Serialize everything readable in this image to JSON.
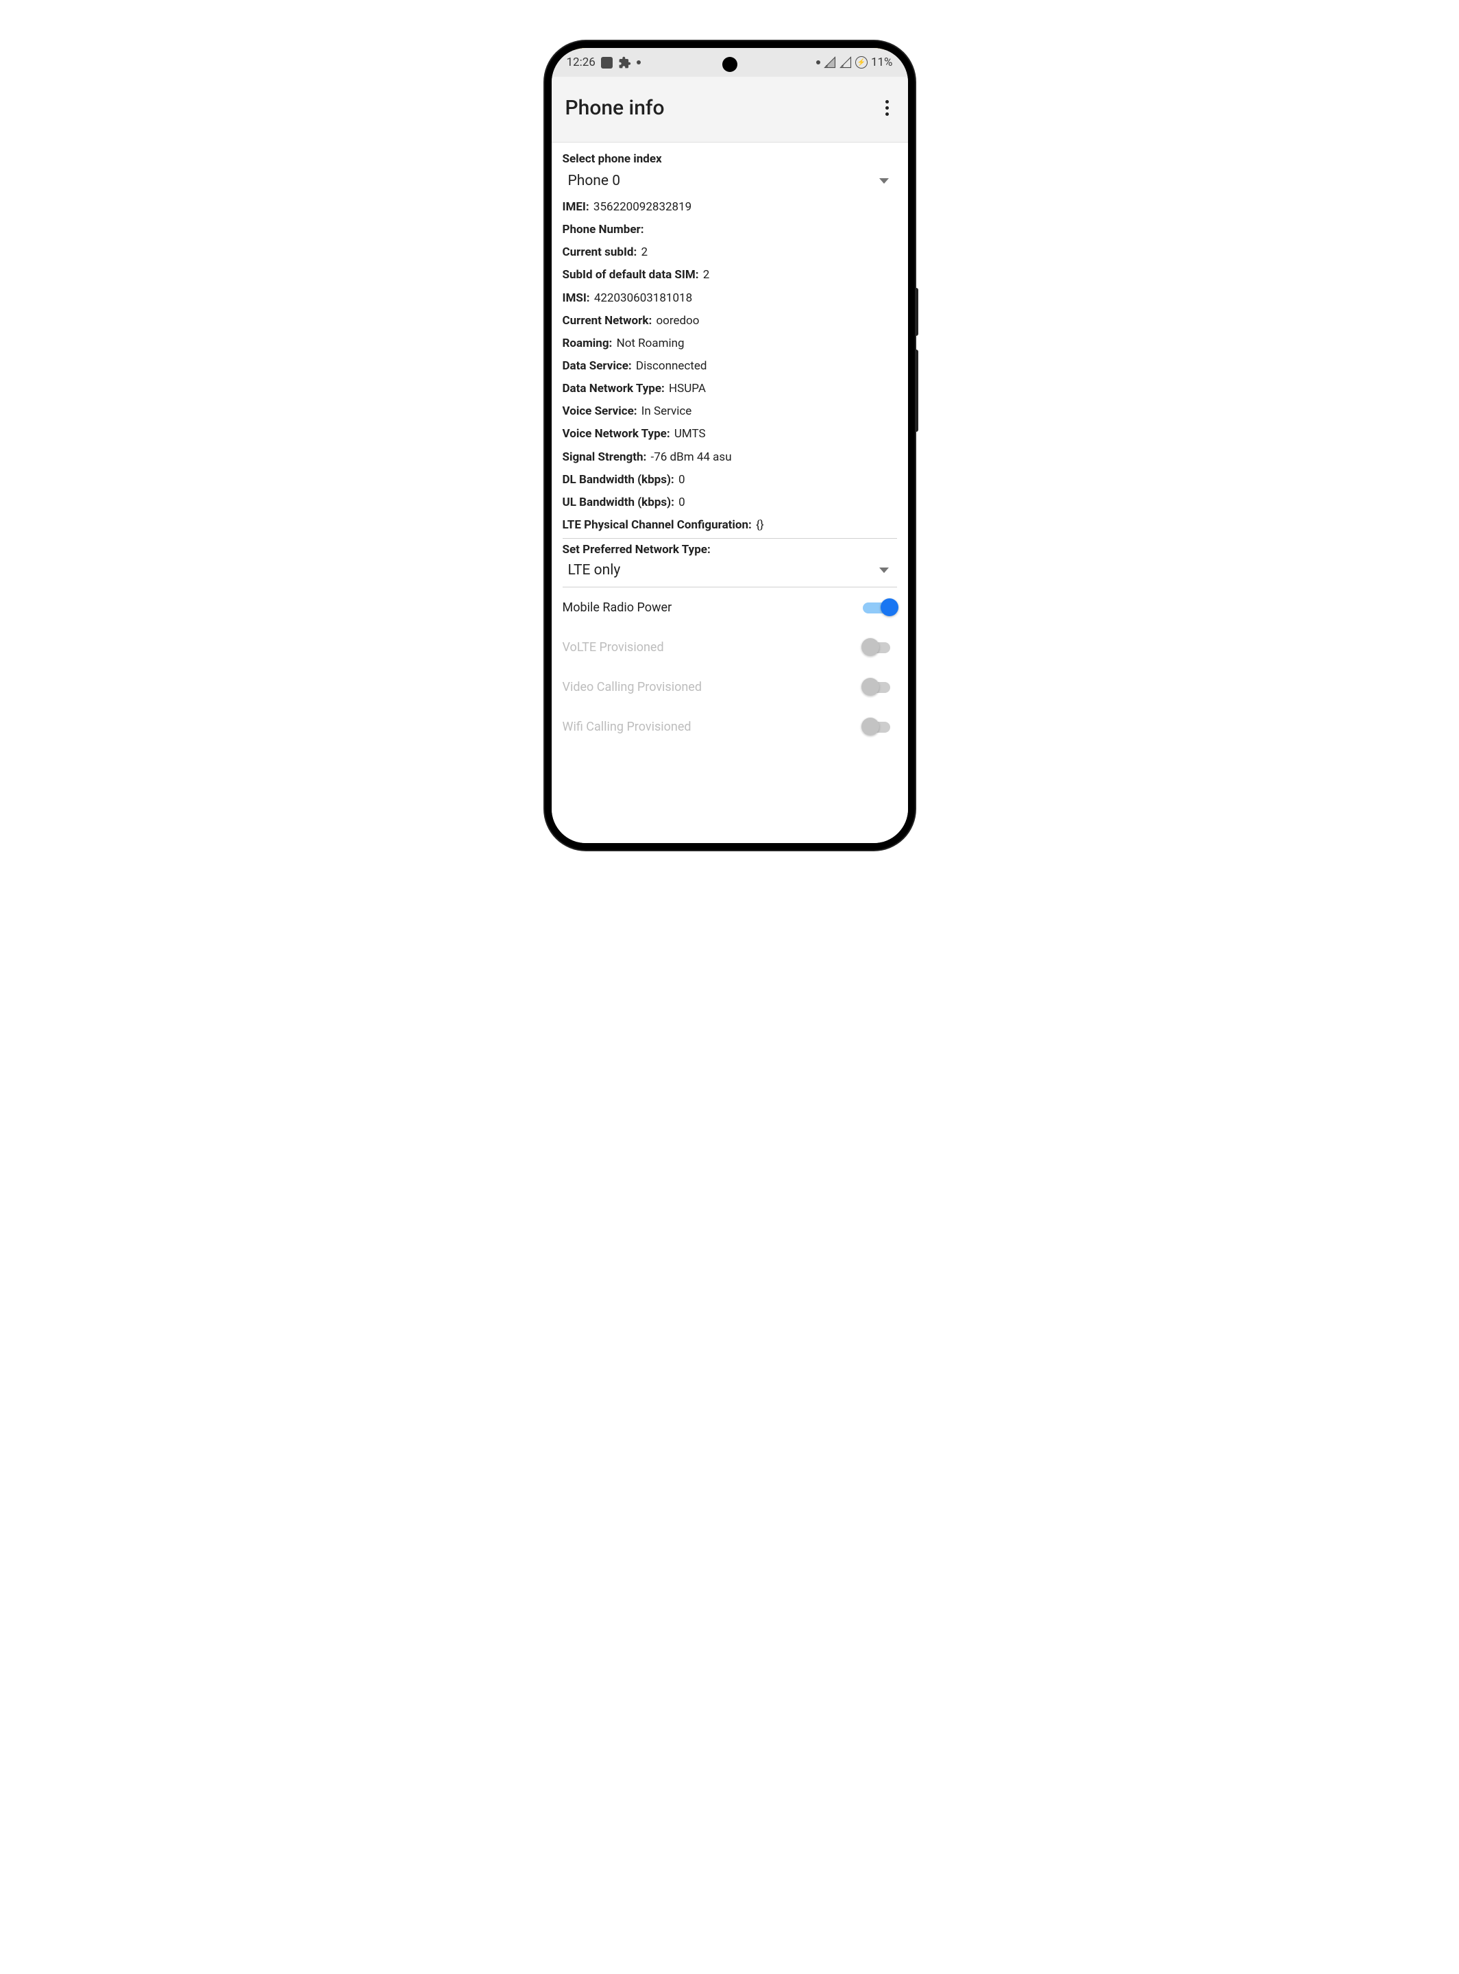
{
  "status_bar": {
    "time": "12:26",
    "battery_text": "11%"
  },
  "app_bar": {
    "title": "Phone info"
  },
  "phone_index": {
    "label": "Select phone index",
    "selected": "Phone 0"
  },
  "info": {
    "imei_label": "IMEI:",
    "imei_value": "356220092832819",
    "phone_number_label": "Phone Number:",
    "phone_number_value": "",
    "current_subid_label": "Current subId:",
    "current_subid_value": "2",
    "default_data_subid_label": "SubId of default data SIM:",
    "default_data_subid_value": "2",
    "imsi_label": "IMSI:",
    "imsi_value": "422030603181018",
    "current_network_label": "Current Network:",
    "current_network_value": "ooredoo",
    "roaming_label": "Roaming:",
    "roaming_value": "Not Roaming",
    "data_service_label": "Data Service:",
    "data_service_value": "Disconnected",
    "data_network_type_label": "Data Network Type:",
    "data_network_type_value": "HSUPA",
    "voice_service_label": "Voice Service:",
    "voice_service_value": "In Service",
    "voice_network_type_label": "Voice Network Type:",
    "voice_network_type_value": "UMTS",
    "signal_strength_label": "Signal Strength:",
    "signal_strength_value": "-76 dBm   44 asu",
    "dl_bandwidth_label": "DL Bandwidth (kbps):",
    "dl_bandwidth_value": "0",
    "ul_bandwidth_label": "UL Bandwidth (kbps):",
    "ul_bandwidth_value": "0",
    "lte_phy_label": "LTE Physical Channel Configuration:",
    "lte_phy_value": "{}"
  },
  "preferred_network": {
    "label": "Set Preferred Network Type:",
    "selected": "LTE only"
  },
  "toggles": {
    "mobile_radio_power": {
      "label": "Mobile Radio Power",
      "on": true,
      "enabled": true
    },
    "volte_provisioned": {
      "label": "VoLTE Provisioned",
      "on": false,
      "enabled": false
    },
    "video_calling_provisioned": {
      "label": "Video Calling Provisioned",
      "on": false,
      "enabled": false
    },
    "wifi_calling_provisioned": {
      "label": "Wifi Calling Provisioned",
      "on": false,
      "enabled": false
    }
  }
}
